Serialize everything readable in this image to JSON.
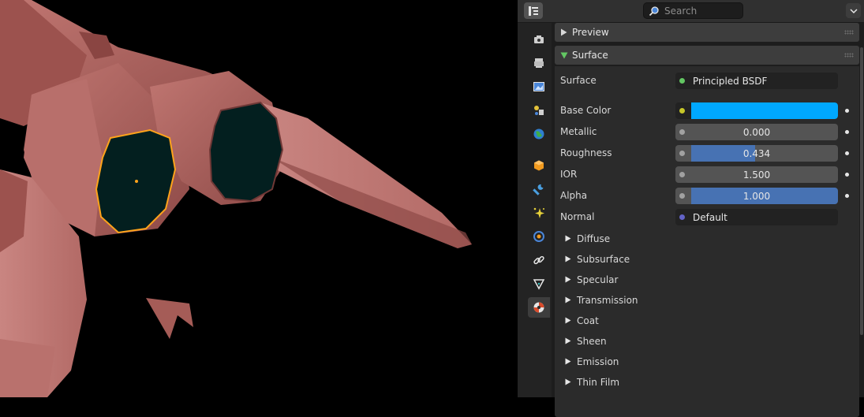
{
  "header": {
    "search_placeholder": "Search",
    "icons": [
      "editor-type-icon",
      "search-icon",
      "chevron-down-icon"
    ]
  },
  "tabs": [
    {
      "name": "tool-tab",
      "icon": "tool-icon"
    },
    {
      "name": "render-tab",
      "icon": "render-icon"
    },
    {
      "name": "output-tab",
      "icon": "output-icon"
    },
    {
      "name": "view-layer-tab",
      "icon": "view-layer-icon"
    },
    {
      "name": "scene-tab",
      "icon": "scene-icon"
    },
    {
      "name": "world-tab",
      "icon": "world-icon"
    },
    {
      "name": "object-tab",
      "icon": "object-icon"
    },
    {
      "name": "modifiers-tab",
      "icon": "wrench-icon"
    },
    {
      "name": "particles-tab",
      "icon": "particles-icon"
    },
    {
      "name": "physics-tab",
      "icon": "physics-icon"
    },
    {
      "name": "constraints-tab",
      "icon": "constraints-icon"
    },
    {
      "name": "data-tab",
      "icon": "mesh-data-icon"
    },
    {
      "name": "material-tab",
      "icon": "material-icon",
      "active": true
    }
  ],
  "panels": {
    "preview": {
      "label": "Preview",
      "expanded": false
    },
    "surface": {
      "label": "Surface",
      "expanded": true
    }
  },
  "surface": {
    "shader_label": "Surface",
    "shader_value": "Principled BSDF",
    "properties": {
      "base_color": {
        "label": "Base Color",
        "color": "#00a8ff"
      },
      "metallic": {
        "label": "Metallic",
        "value": "0.000",
        "fraction": 0.0
      },
      "roughness": {
        "label": "Roughness",
        "value": "0.434",
        "fraction": 0.434
      },
      "ior": {
        "label": "IOR",
        "value": "1.500",
        "fraction": 0.0
      },
      "alpha": {
        "label": "Alpha",
        "value": "1.000",
        "fraction": 1.0
      },
      "normal": {
        "label": "Normal",
        "value": "Default"
      }
    },
    "subpanels": [
      "Diffuse",
      "Subsurface",
      "Specular",
      "Transmission",
      "Coat",
      "Sheen",
      "Emission",
      "Thin Film"
    ]
  },
  "colors": {
    "accent_blue": "#4772b3",
    "shader_socket": "#63c763",
    "color_socket": "#c7c729",
    "float_socket": "#a1a1a1",
    "vector_socket": "#6363c7",
    "selection_orange": "#ffa31a",
    "model_color": "#b96a64"
  }
}
